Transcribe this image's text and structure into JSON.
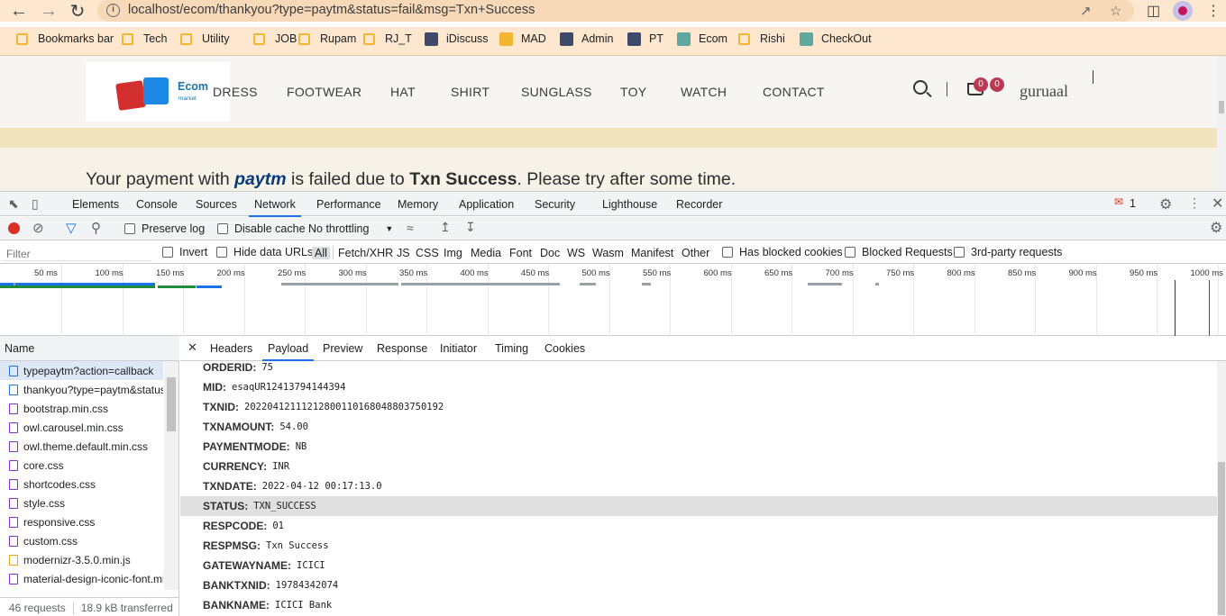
{
  "browser": {
    "url": "localhost/ecom/thankyou?type=paytm&status=fail&msg=Txn+Success",
    "bookmarks": [
      {
        "label": "Bookmarks bar",
        "kind": "folder"
      },
      {
        "label": "Tech",
        "kind": "folder"
      },
      {
        "label": "Utility",
        "kind": "folder"
      },
      {
        "label": "JOB",
        "kind": "folder"
      },
      {
        "label": "Rupam",
        "kind": "folder"
      },
      {
        "label": "RJ_T",
        "kind": "folder"
      },
      {
        "label": "iDiscuss",
        "kind": "site"
      },
      {
        "label": "MAD",
        "kind": "site"
      },
      {
        "label": "Admin",
        "kind": "site"
      },
      {
        "label": "PT",
        "kind": "site"
      },
      {
        "label": "Ecom",
        "kind": "site"
      },
      {
        "label": "Rishi",
        "kind": "folder"
      },
      {
        "label": "CheckOut",
        "kind": "site"
      }
    ]
  },
  "site": {
    "logo_text": "Ecom",
    "logo_sub": "market",
    "menu": [
      "DRESS",
      "FOOTWEAR",
      "HAT",
      "SHIRT",
      "SUNGLASS",
      "TOY",
      "WATCH",
      "CONTACT"
    ],
    "cart_count": "0",
    "wishlist_count": "0",
    "username": "guruaal",
    "message": {
      "before": "Your payment with",
      "brand": "paytm",
      "middle": "is failed due to",
      "reason": "Txn Success",
      "after": ". Please try after some time."
    }
  },
  "devtools": {
    "panels": [
      "Elements",
      "Console",
      "Sources",
      "Network",
      "Performance",
      "Memory",
      "Application",
      "Security",
      "Lighthouse",
      "Recorder"
    ],
    "active_panel": "Network",
    "error_count": "1",
    "toolbar": {
      "preserve_log": "Preserve log",
      "disable_cache": "Disable cache",
      "throttling": "No throttling"
    },
    "filter": {
      "placeholder": "Filter",
      "invert": "Invert",
      "hide_data_urls": "Hide data URLs",
      "types": [
        "All",
        "Fetch/XHR",
        "JS",
        "CSS",
        "Img",
        "Media",
        "Font",
        "Doc",
        "WS",
        "Wasm",
        "Manifest",
        "Other"
      ],
      "has_blocked_cookies": "Has blocked cookies",
      "blocked_requests": "Blocked Requests",
      "third_party": "3rd-party requests"
    },
    "timeline_ticks": [
      "50 ms",
      "100 ms",
      "150 ms",
      "200 ms",
      "250 ms",
      "300 ms",
      "350 ms",
      "400 ms",
      "450 ms",
      "500 ms",
      "550 ms",
      "600 ms",
      "650 ms",
      "700 ms",
      "750 ms",
      "800 ms",
      "850 ms",
      "900 ms",
      "950 ms",
      "1000 ms"
    ],
    "name_header": "Name",
    "requests": [
      {
        "name": "typepaytm?action=callback",
        "type": "doc"
      },
      {
        "name": "thankyou?type=paytm&status=fail&msg=Txn+Success",
        "type": "doc"
      },
      {
        "name": "bootstrap.min.css",
        "type": "css"
      },
      {
        "name": "owl.carousel.min.css",
        "type": "css"
      },
      {
        "name": "owl.theme.default.min.css",
        "type": "css"
      },
      {
        "name": "core.css",
        "type": "css"
      },
      {
        "name": "shortcodes.css",
        "type": "css"
      },
      {
        "name": "style.css",
        "type": "css"
      },
      {
        "name": "responsive.css",
        "type": "css"
      },
      {
        "name": "custom.css",
        "type": "css"
      },
      {
        "name": "modernizr-3.5.0.min.js",
        "type": "js"
      },
      {
        "name": "material-design-iconic-font.min.css",
        "type": "css"
      }
    ],
    "summary": {
      "requests": "46 requests",
      "transferred": "18.9 kB transferred"
    },
    "detail_tabs": [
      "Headers",
      "Payload",
      "Preview",
      "Response",
      "Initiator",
      "Timing",
      "Cookies"
    ],
    "active_detail_tab": "Payload",
    "payload": [
      {
        "key": "ORDERID:",
        "value": "75"
      },
      {
        "key": "MID:",
        "value": "esaqUR12413794144394"
      },
      {
        "key": "TXNID:",
        "value": "20220412111212800110168048803750192"
      },
      {
        "key": "TXNAMOUNT:",
        "value": "54.00"
      },
      {
        "key": "PAYMENTMODE:",
        "value": "NB"
      },
      {
        "key": "CURRENCY:",
        "value": "INR"
      },
      {
        "key": "TXNDATE:",
        "value": "2022-04-12 00:17:13.0"
      },
      {
        "key": "STATUS:",
        "value": "TXN_SUCCESS"
      },
      {
        "key": "RESPCODE:",
        "value": "01"
      },
      {
        "key": "RESPMSG:",
        "value": "Txn Success"
      },
      {
        "key": "GATEWAYNAME:",
        "value": "ICICI"
      },
      {
        "key": "BANKTXNID:",
        "value": "19784342074"
      },
      {
        "key": "BANKNAME:",
        "value": "ICICI Bank"
      }
    ],
    "highlighted_row": "STATUS:"
  }
}
